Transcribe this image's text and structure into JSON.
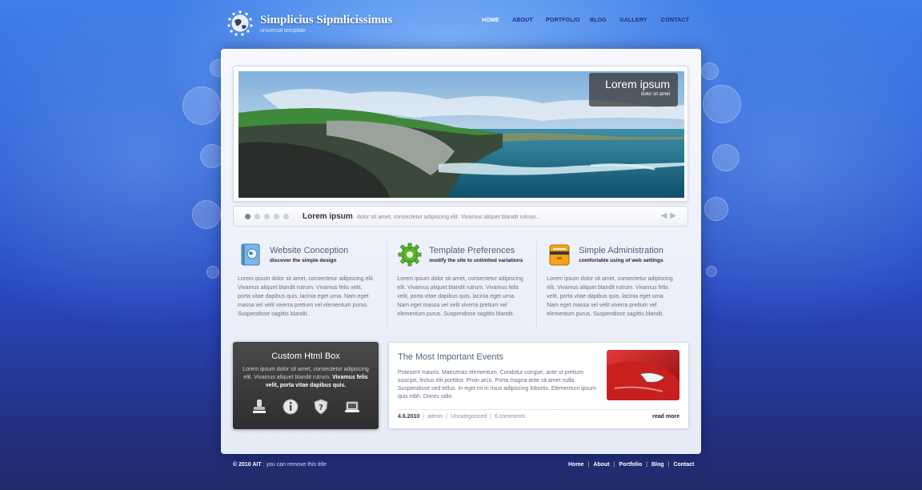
{
  "header": {
    "site_title": "Simplicius Sipmlicissimus",
    "site_subtitle": "universal template",
    "nav": [
      {
        "label": "HOME",
        "active": true
      },
      {
        "label": "ABOUT"
      },
      {
        "label": "PORTFOLIO"
      },
      {
        "label": "BLOG"
      },
      {
        "label": "GALLERY"
      },
      {
        "label": "CONTACT"
      }
    ]
  },
  "slider": {
    "caption_title": "Lorem ipsum",
    "caption_subtitle": "dolor sit amet",
    "image_icon": "coastal-cliffs-photo"
  },
  "ticker": {
    "title": "Lorem ipsum",
    "text": "dolor sit amet, consectetur adipiscing elit. Vivamus aliquet blandit rutrum...",
    "dots": 5,
    "active_dot": 0,
    "prev_icon": "arrow-left-icon",
    "next_icon": "arrow-right-icon"
  },
  "features": [
    {
      "title": "Website Conception",
      "subtitle": "discover the simple design",
      "body": "Lorem ipsum dolor sit amet, consectetur adipiscing elit. Vivamus aliquet blandit rutrum. Vivamus felis velit, porta vitae dapibus quis, lacinia eget urna. Nam eget massa vel velit viverra pretium vel elementum purus. Suspendisse sagittis blandit.",
      "icon": "book-globe-icon"
    },
    {
      "title": "Template Preferences",
      "subtitle": "modify the site to unlimited variations",
      "body": "Lorem ipsum dolor sit amet, consectetur adipiscing elit. Vivamus aliquet blandit rutrum. Vivamus felis velit, porta vitae dapibus quis, lacinia eget urna. Nam eget massa vel velit viverra pretium vel elementum purus. Suspendisse sagittis blandit.",
      "icon": "gear-icon"
    },
    {
      "title": "Simple Administration",
      "subtitle": "comfortable using of web settings",
      "body": "Lorem ipsum dolor sit amet, consectetur adipiscing elit. Vivamus aliquet blandit rutrum. Vivamus felis velit, porta vitae dapibus quis, lacinia eget urna. Nam eget massa vel velit viverra pretium vel elementum purus. Suspendisse sagittis blandit.",
      "icon": "toolbox-icon"
    }
  ],
  "custom_box": {
    "title": "Custom Html Box",
    "text": "Lorem ipsum dolor sit amet, consectetur adipiscing elit. Vivamus aliquet blandit rutrum.",
    "bold_text": "Vivamus felis velit, porta vitae dapibus quis.",
    "icons": [
      "stamp-icon",
      "info-icon",
      "shield-help-icon",
      "laptop-icon"
    ]
  },
  "events": {
    "title": "The Most Important Events",
    "text": "Praesent mauris. Maecenas elementum. Curabitur congue, ante ut pretium suscipit, lectus elit porttitor. Proin arcu. Porta magna ante sit amet nulla. Suspendisse sed tellus. In eget mi in risus adipiscing lobortis. Elementum ipsum quis nibh. Donec odio.",
    "date": "4.6.2010",
    "author": "admin",
    "category": "Uncategorized",
    "comments": "6 comments",
    "read_more": "read more",
    "image_icon": "red-car-photo"
  },
  "footer": {
    "copyright_bold": "© 2010 AIT",
    "copyright_text": ": you can remove this title",
    "links": [
      "Home",
      "About",
      "Portfolio",
      "Blog",
      "Contact"
    ]
  }
}
